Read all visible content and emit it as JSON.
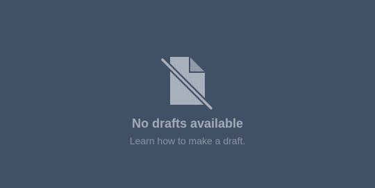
{
  "empty_state": {
    "icon": "no-document-icon",
    "title": "No drafts available",
    "link_text": "Learn how to make a draft."
  },
  "colors": {
    "background": "#425066",
    "icon": "#a8b0bc",
    "title": "#a3abb8",
    "link": "#8a94a5"
  }
}
